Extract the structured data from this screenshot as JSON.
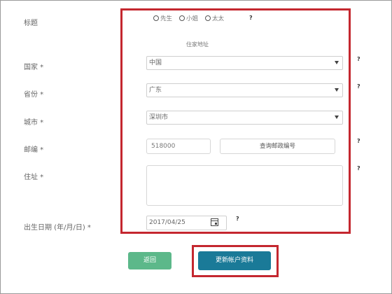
{
  "form": {
    "title_label": "标题",
    "salutations": [
      "先生",
      "小姐",
      "太太"
    ],
    "section_note": "住家地址",
    "country": {
      "label": "国家 *",
      "value": "中国"
    },
    "province": {
      "label": "省份 *",
      "value": "广东"
    },
    "city": {
      "label": "城市 *",
      "value": "深圳市"
    },
    "postcode": {
      "label": "邮编 *",
      "value": "518000",
      "lookup_button": "查询邮政编号"
    },
    "address": {
      "label": "住址 *",
      "value": ""
    },
    "birthdate": {
      "label": "出生日期 (年/月/日) *",
      "value": "2017/04/25"
    },
    "help_icon": "?"
  },
  "actions": {
    "back": "返回",
    "update": "更新帐户资料"
  },
  "colors": {
    "highlight": "#c4272f",
    "back_button": "#5cb88a",
    "update_button": "#1a7a98"
  }
}
